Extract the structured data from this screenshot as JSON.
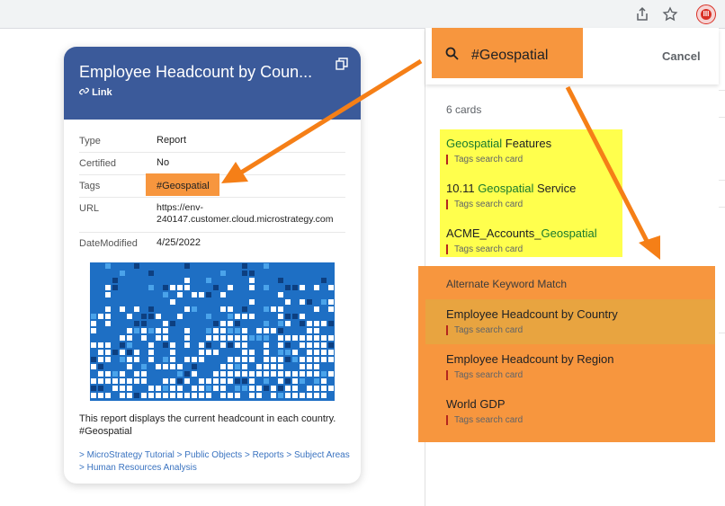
{
  "browser": {
    "share_icon": "share-icon",
    "star_icon": "star-icon",
    "extension_icon": "microstrategy-extension-icon"
  },
  "card": {
    "title": "Employee Headcount by Coun...",
    "link_label": "Link",
    "fields": [
      {
        "key": "Type",
        "value": "Report"
      },
      {
        "key": "Certified",
        "value": "No"
      },
      {
        "key": "Tags",
        "value": "#Geospatial"
      },
      {
        "key": "URL",
        "value": "https://env-240147.customer.cloud.microstrategy.com"
      },
      {
        "key": "DateModified",
        "value": "4/25/2022"
      }
    ],
    "url_line1": "https://env-",
    "url_line2": "240147.customer.cloud.microstrategy.com",
    "description_line1": "This report displays the current headcount in each country.",
    "description_line2": "#Geospatial",
    "breadcrumb_line1": "> MicroStrategy Tutorial > Public Objects > Reports > Subject Areas",
    "breadcrumb_line2": "> Human Resources Analysis"
  },
  "search": {
    "query": "#Geospatial",
    "cancel_label": "Cancel",
    "count_label": "6 cards",
    "tag_matches": [
      {
        "title_pre": "",
        "title_match": "Geospatial",
        "title_post": " Features",
        "subtitle": "Tags search card"
      },
      {
        "title_pre": "10.11 ",
        "title_match": "Geospatial",
        "title_post": " Service",
        "subtitle": "Tags search card"
      },
      {
        "title_pre": "ACME_Accounts_",
        "title_match": "Geospatial",
        "title_post": "",
        "subtitle": "Tags search card"
      }
    ],
    "alternate_label": "Alternate Keyword Match",
    "alternate_matches": [
      {
        "title": "Employee Headcount by Country",
        "subtitle": "Tags search card"
      },
      {
        "title": "Employee Headcount by Region",
        "subtitle": "Tags search card"
      },
      {
        "title": "World GDP",
        "subtitle": "Tags search card"
      }
    ]
  },
  "colors": {
    "card_header": "#3b5a9a",
    "highlight_orange": "#f7963e",
    "highlight_yellow": "#ffff4d",
    "match_green": "#1a7a2e",
    "arrow_orange": "#f57f17"
  }
}
